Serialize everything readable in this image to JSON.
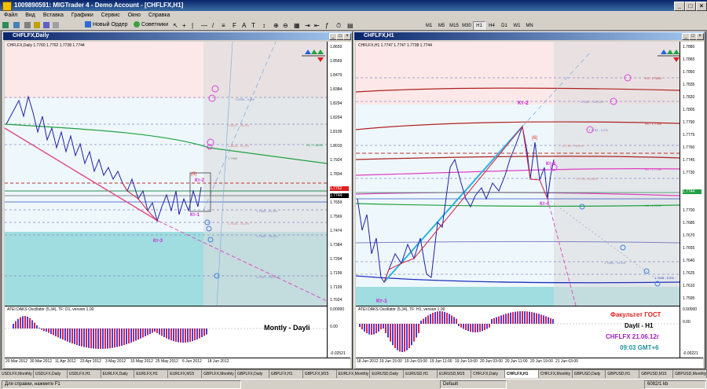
{
  "app": {
    "title": "1009890591: MIGTrader 4 - Demo Account - [CHFLFX,H1]"
  },
  "menu": [
    "Файл",
    "Вид",
    "Вставка",
    "Графики",
    "Сервис",
    "Окно",
    "Справка"
  ],
  "toolbar": {
    "new_order": "Новый Ордер",
    "advisors": "Советники",
    "timeframes": [
      "M1",
      "M5",
      "M15",
      "M30",
      "H1",
      "H4",
      "D1",
      "W1",
      "MN"
    ],
    "selected_tf": "H1"
  },
  "left_window": {
    "title": "CHFLFX,Daily",
    "header": "CHFLFX,Daily  1.7760 1.7762 1.7738 1.7744",
    "yaxis": [
      "1.8659",
      "1.8569",
      "1.8479",
      "1.8384",
      "1.8294",
      "1.8204",
      "1.8109",
      "1.8019",
      "1.7924",
      "1.7834",
      "1.7744",
      "1.7659",
      "1.7569",
      "1.7474",
      "1.7384",
      "1.7294",
      "1.7199",
      "1.7109",
      "1.7024"
    ],
    "price_tag": "1.7762",
    "price_tag2": "1.7744",
    "labels": {
      "kt1": "Кт-1",
      "kt2": "Кт-2",
      "kt3": "Кт-3",
      "point": "(6)"
    },
    "levels": [
      "1.8396 - 0.0%",
      "1.8247 - 25.0%",
      "1.8046 - 61.8%",
      "1.7969",
      "1.7819 - 0.0%",
      "1.7659 - 61.8%",
      "1.7545 - 76.4%",
      "1.7469 - 76.4%",
      "1.7297 - 100.0%",
      "H1 - 1.8050"
    ],
    "osc_header": "ATEI DAKS Oscillator (5,34), TF: D1, version 1.00",
    "osc_axis": [
      "0.00000",
      "0.00",
      "-0.02521"
    ],
    "osc_caption": "Montly - Dayli",
    "xaxis": [
      "20 Mar 2012",
      "30 Mar 2012",
      "11 Apr 2012",
      "23 Apr 2012",
      "3 May 2012",
      "15 May 2012",
      "25 May 2012",
      "6 Jun 2012",
      "18 Jun 2012"
    ]
  },
  "right_window": {
    "title": "CHFLFX,H1",
    "header": "CHFLFX,H1  1.7747 1.7747 1.7738 1.7744",
    "yaxis": [
      "1.7880",
      "1.7865",
      "1.7850",
      "1.7835",
      "1.7820",
      "1.7805",
      "1.7790",
      "1.7775",
      "1.7760",
      "1.7745",
      "1.7730",
      "1.7715",
      "1.7700",
      "1.7685",
      "1.7670",
      "1.7655",
      "1.7640",
      "1.7625",
      "1.7610",
      "1.7595"
    ],
    "price_tag": "1.7744",
    "labels": {
      "kt1": "Кт-1",
      "kt2": "Кт-2",
      "kt3": "Кт-3",
      "kt4": "Кт-4",
      "point": "(6)"
    },
    "levels": [
      "H1 - 1.7820",
      "1.7807 - 100.0%",
      "1.7789 - 0.0%",
      "H1 - 1.7789",
      "1.7769 - 76.4%",
      "H1 - 1.7750",
      "1.7744 - 61.8%",
      "H1 - 1.7645",
      "1.7645 - 0.0%",
      "1.7659 - 76.4%"
    ],
    "osc_header": "ATEI DAKS Oscillator (5,34), TF: H1, version 1.00",
    "osc_axis": [
      "0.00000",
      "0.00",
      "-0.00221"
    ],
    "caption": {
      "line1": "Факультет ГОСТ",
      "line2": "Dayli - H1",
      "line3": "CHFLFX 21.06.12г",
      "line4": "09:03 GMT+6"
    },
    "xaxis": [
      "18 Jun 2012",
      "19 Jun 15:00",
      "19 Jun 03:00",
      "19 Jun 11:00",
      "19 Jun 19:00",
      "20 Jun 03:00",
      "20 Jun 11:00",
      "20 Jun 19:00",
      "21 Jun 03:00"
    ]
  },
  "tabs": [
    "USDLFX,Monthly",
    "USDLFX,Daily",
    "USDLFX,H1",
    "EURLFX,Daily",
    "EURLFX,H1",
    "EURLFX,M15",
    "GBPLFX,Monthly",
    "GBPLFX,Daily",
    "GBPLFX,H1",
    "GBPLFX,M15",
    "EURLFX,Monthly",
    "EURUSD,Daily",
    "EURUSD,H1",
    "EURUSD,M15",
    "CHFLFX,Daily",
    "CHFLFX,H1",
    "CHFLFX,Monthly",
    "GBPUSD,Daily",
    "GBPUSD,H1",
    "GBPUSD,M15",
    "GBPUSD,Monthly"
  ],
  "selected_tab": "CHFLFX,H1",
  "status": {
    "help": "Для справки, нажмите F1",
    "profile": "Default",
    "traffic": "6082/1 kb"
  }
}
